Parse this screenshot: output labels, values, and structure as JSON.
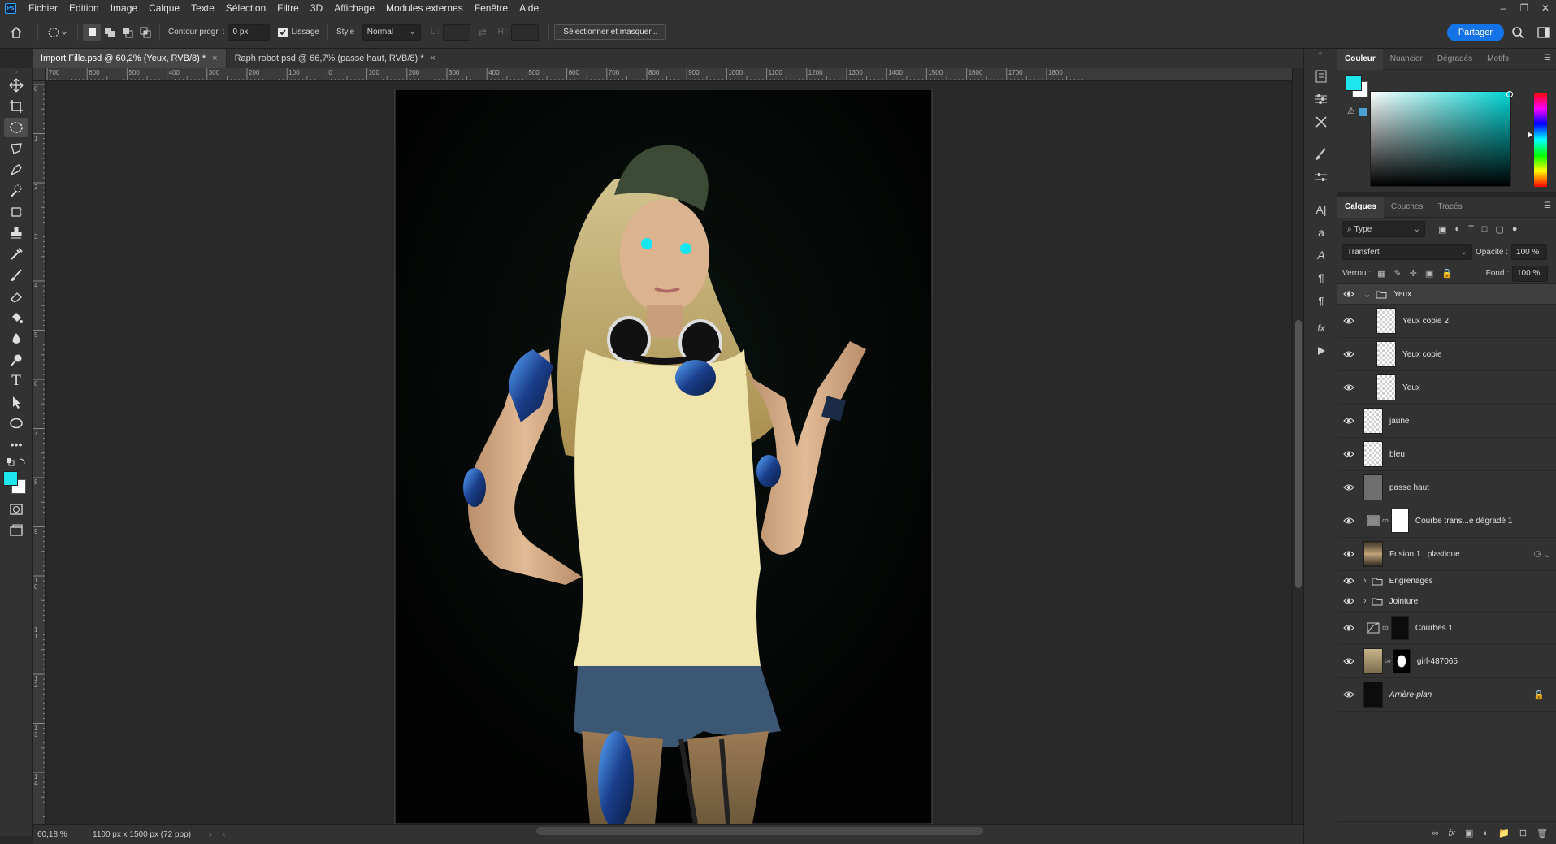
{
  "menubar": {
    "logo": "Ps",
    "items": [
      "Fichier",
      "Edition",
      "Image",
      "Calque",
      "Texte",
      "Sélection",
      "Filtre",
      "3D",
      "Affichage",
      "Modules externes",
      "Fenêtre",
      "Aide"
    ]
  },
  "options": {
    "feather_label": "Contour progr. :",
    "feather_value": "0 px",
    "antialias_label": "Lissage",
    "style_label": "Style :",
    "style_value": "Normal",
    "width_label": "L :",
    "height_label": "H :",
    "select_mask": "Sélectionner et masquer...",
    "share": "Partager"
  },
  "tabs": [
    {
      "label": "Import Fille.psd @ 60,2% (Yeux, RVB/8) *",
      "close": "×"
    },
    {
      "label": "Raph robot.psd @ 66,7% (passe haut, RVB/8) *",
      "close": "×"
    }
  ],
  "ruler": {
    "top": [
      "700",
      "600",
      "500",
      "400",
      "300",
      "200",
      "100",
      "0",
      "100",
      "200",
      "300",
      "400",
      "500",
      "600",
      "700",
      "800",
      "900",
      "1000",
      "1100",
      "1200",
      "1300",
      "1400",
      "1500",
      "1600",
      "1700",
      "1800"
    ],
    "left": [
      "0",
      "1",
      "2",
      "3",
      "4",
      "5",
      "6",
      "7",
      "8",
      "9",
      "1 0",
      "1 1",
      "1 2",
      "1 3",
      "1 4"
    ]
  },
  "status": {
    "zoom": "60,18 %",
    "doc_info": "1100 px x 1500 px (72 ppp)",
    "arrow": "›"
  },
  "color_panel": {
    "tabs": [
      "Couleur",
      "Nuancier",
      "Dégradés",
      "Motifs"
    ],
    "foreground": "#1de6ec",
    "background": "#ffffff",
    "hue_color": "#00d5d5"
  },
  "layers_panel": {
    "tabs": [
      "Calques",
      "Couches",
      "Tracés"
    ],
    "filter_value": "Type",
    "blend_mode": "Transfert",
    "opacity_label": "Opacité :",
    "opacity_value": "100 %",
    "lock_label": "Verrou :",
    "fill_label": "Fond :",
    "fill_value": "100 %",
    "layers": [
      {
        "name": "Yeux",
        "kind": "group-open"
      },
      {
        "name": "Yeux copie 2",
        "kind": "transparent",
        "indent": true
      },
      {
        "name": "Yeux copie",
        "kind": "transparent",
        "indent": true
      },
      {
        "name": "Yeux",
        "kind": "transparent",
        "indent": true
      },
      {
        "name": "jaune",
        "kind": "transparent"
      },
      {
        "name": "bleu",
        "kind": "transparent"
      },
      {
        "name": "passe haut",
        "kind": "gray"
      },
      {
        "name": "Courbe trans...e dégradé 1",
        "kind": "adjust-gradient"
      },
      {
        "name": "Fusion 1 : plastique",
        "kind": "photo"
      },
      {
        "name": "Engrenages",
        "kind": "group"
      },
      {
        "name": "Jointure",
        "kind": "group"
      },
      {
        "name": "Courbes 1",
        "kind": "adjust-curves"
      },
      {
        "name": "girl-487065",
        "kind": "photo-mask"
      },
      {
        "name": "Arrière-plan",
        "kind": "background"
      }
    ]
  }
}
